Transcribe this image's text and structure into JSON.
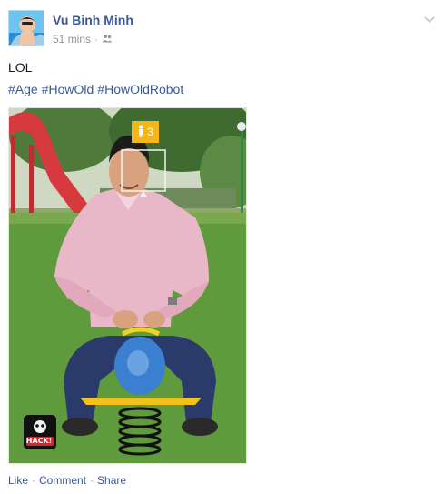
{
  "post": {
    "author": "Vu Binh Minh",
    "time": "51 mins",
    "separator": "·",
    "status": "LOL",
    "hashtags": [
      "#Age",
      "#HowOld",
      "#HowOldRobot"
    ],
    "age_badge": "3",
    "watermark": "HACK!",
    "actions": {
      "like": "Like",
      "comment": "Comment",
      "share": "Share",
      "sep": "·"
    }
  },
  "icons": {
    "audience": "friends-icon",
    "options": "chevron-down-icon",
    "badge": "person-icon"
  },
  "colors": {
    "link": "#3b5998",
    "meta": "#90949c",
    "badge": "#f3b61d"
  }
}
